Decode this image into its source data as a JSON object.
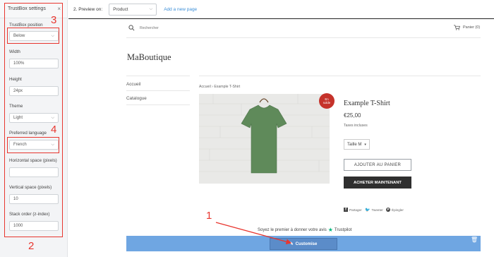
{
  "settings": {
    "title": "TrustBox settings",
    "close": "×",
    "fields": {
      "position": {
        "label": "TrustBox position",
        "value": "Below"
      },
      "width": {
        "label": "Width",
        "value": "100%"
      },
      "height": {
        "label": "Height",
        "value": "24px"
      },
      "theme": {
        "label": "Theme",
        "value": "Light"
      },
      "language": {
        "label": "Preferred language",
        "value": "French"
      },
      "hspace": {
        "label": "Horizontal space (pixels)",
        "value": ""
      },
      "vspace": {
        "label": "Vertical space (pixels)",
        "value": "10"
      },
      "stack": {
        "label": "Stack order (z-index)",
        "value": "1000"
      }
    }
  },
  "topbar": {
    "preview_label": "2. Preview on:",
    "preview_value": "Product",
    "add_page": "Add a new page"
  },
  "annotations": {
    "n1": "1",
    "n2": "2",
    "n3": "3",
    "n4": "4",
    "color": "#e8362f"
  },
  "store": {
    "search_placeholder": "Rechercher",
    "cart": "Panier (0)",
    "brand": "MaBoutique",
    "nav": [
      "Accueil",
      "Catalogue"
    ],
    "breadcrumb": "Accueil  ›  Example T-Shirt",
    "badge_line1": "En",
    "badge_line2": "solde",
    "product_title": "Example T-Shirt",
    "price": "€25,00",
    "taxes": "Taxes incluses",
    "size": "Taille M",
    "add_to_cart": "AJOUTER AU PANIER",
    "buy_now": "ACHETER MAINTENANT",
    "share": {
      "facebook": "Partager",
      "twitter": "Tweeter",
      "pinterest": "Épingler"
    },
    "trustpilot_text": "Soyez le premier à donner votre avis",
    "trustpilot_brand": "Trustpilot",
    "customise": "Customise",
    "shirt_color": "#5f8a5a"
  }
}
